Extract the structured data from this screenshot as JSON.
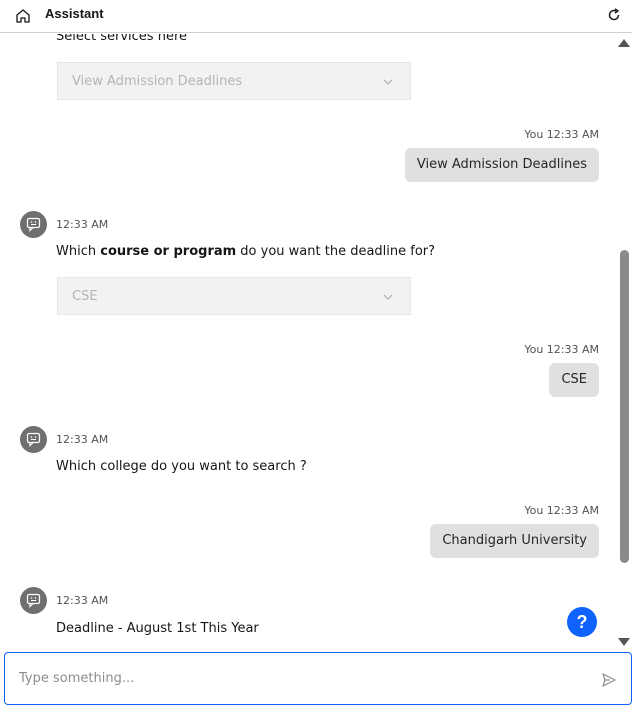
{
  "header": {
    "title": "Assistant",
    "home_icon": "home-icon",
    "refresh_icon": "refresh-icon"
  },
  "messages": [
    {
      "type": "bot_text",
      "text": "Select services here"
    },
    {
      "type": "select",
      "value": "View Admission Deadlines"
    },
    {
      "type": "user",
      "time": "You 12:33 AM",
      "text": "View Admission Deadlines"
    },
    {
      "type": "bot",
      "time": "12:33 AM",
      "text_before": "Which ",
      "text_bold": "course or program",
      "text_after": " do you want the deadline for?"
    },
    {
      "type": "select",
      "value": "CSE"
    },
    {
      "type": "user",
      "time": "You 12:33 AM",
      "text": "CSE"
    },
    {
      "type": "bot",
      "time": "12:33 AM",
      "text": "Which college do you want to search ?"
    },
    {
      "type": "user",
      "time": "You 12:33 AM",
      "text": "Chandigarh University"
    },
    {
      "type": "bot",
      "time": "12:33 AM",
      "text": "Deadline - August 1st This Year"
    }
  ],
  "help_button": {
    "label": "?",
    "color": "#0f62fe"
  },
  "composer": {
    "placeholder": "Type something...",
    "send_icon": "send-icon"
  },
  "colors": {
    "accent": "#0f62fe",
    "bubble": "#e0e0e0",
    "select_bg": "#f2f2f2",
    "avatar": "#6f6f6f"
  }
}
